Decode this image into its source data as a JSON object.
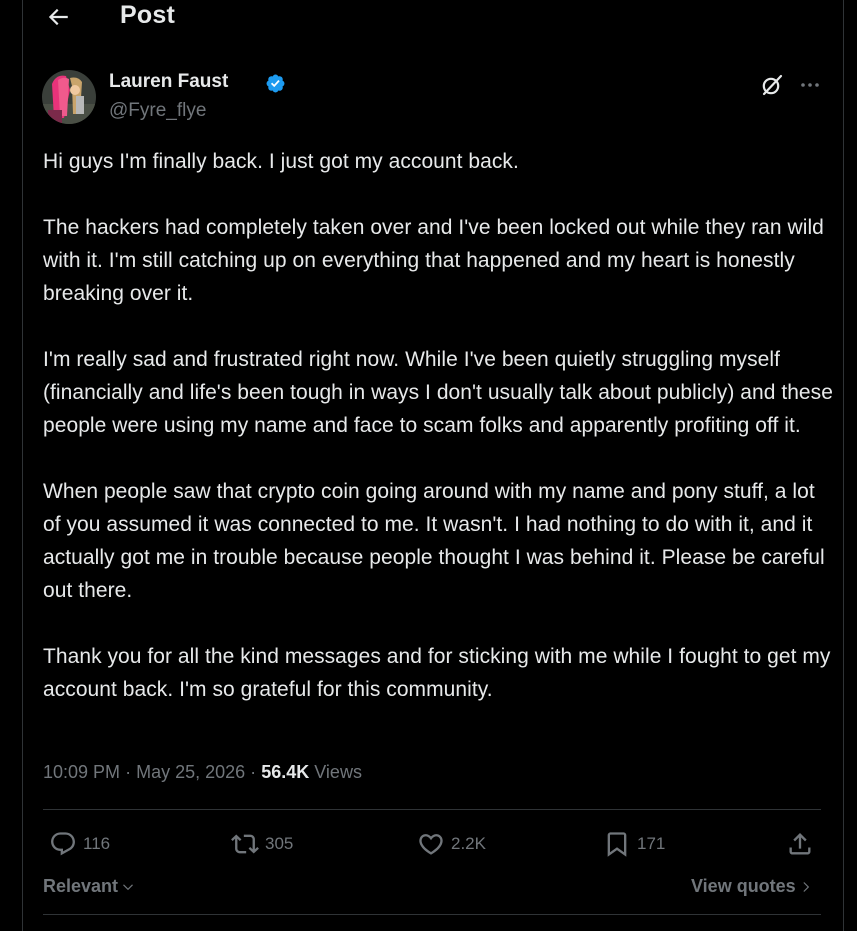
{
  "header": {
    "title": "Post",
    "back_icon": "arrow-left-icon"
  },
  "author": {
    "name": "Lauren Faust",
    "handle": "@Fyre_flye",
    "verified": true,
    "verified_color": "#1d9bf0"
  },
  "post": {
    "paragraphs": [
      "Hi guys I'm finally back. I just got my account back.",
      "The hackers had completely taken over and I've been locked out while they ran wild with it. I'm still catching up on everything that happened and my heart is honestly breaking over it.",
      "I'm really sad and frustrated right now. While I've been quietly struggling myself (financially and life's been tough in ways I don't usually talk about publicly) and these people were using my name and face to scam folks and apparently profiting off it.",
      "When people saw that crypto coin going around with my name and pony stuff, a lot of you assumed it was connected to me. It wasn't. I had nothing to do with it, and it actually got me in trouble because people thought I was behind it. Please be careful out there.",
      "Thank you for all the kind messages and for sticking with me while I fought to get my account back. I'm so grateful for this community."
    ],
    "time": "10:09 PM",
    "separator": "·",
    "date": "May 25, 2026",
    "views_count": "56.4K",
    "views_label": "Views"
  },
  "actions": {
    "replies": "116",
    "reposts": "305",
    "likes": "2.2K",
    "bookmarks": "171"
  },
  "footer": {
    "sort_label": "Relevant",
    "quotes_label": "View quotes"
  },
  "colors": {
    "background": "#000000",
    "text_primary": "#e7e9ea",
    "text_secondary": "#71767b",
    "border": "#2f3336",
    "accent": "#1d9bf0"
  }
}
